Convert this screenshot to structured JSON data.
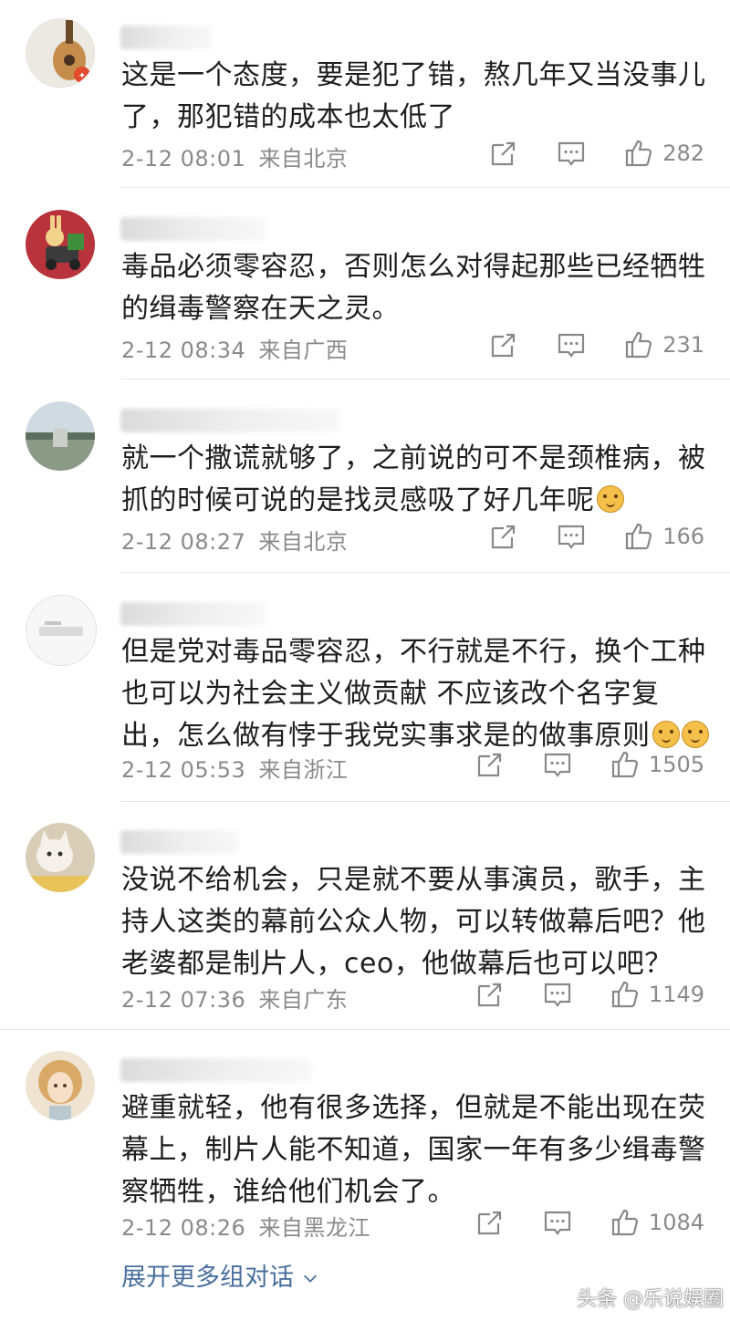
{
  "colors": {
    "text": "#1e1e1e",
    "meta": "#8a8a8a",
    "link": "#4a6f9e",
    "divider": "#e6e6e6"
  },
  "comments": [
    {
      "text": "这是一个态度，要是犯了错，熬几年又当没事儿了，那犯错的成本也太低了",
      "emoji": "",
      "timestamp": "2-12 08:01",
      "location": "来自北京",
      "likes": "282"
    },
    {
      "text": "毒品必须零容忍，否则怎么对得起那些已经牺牲的缉毒警察在天之灵。",
      "emoji": "",
      "timestamp": "2-12 08:34",
      "location": "来自广西",
      "likes": "231"
    },
    {
      "text": "就一个撒谎就够了，之前说的可不是颈椎病，被抓的时候可说的是找灵感吸了好几年呢",
      "emoji": "dog-emoji",
      "timestamp": "2-12 08:27",
      "location": "来自北京",
      "likes": "166"
    },
    {
      "text": "但是党对毒品零容忍，不行就是不行，换个工种也可以为社会主义做贡献 不应该改个名字复出，怎么做有悖于我党实事求是的做事原则",
      "emoji": "dog-emoji x2",
      "timestamp": "2-12 05:53",
      "location": "来自浙江",
      "likes": "1505"
    },
    {
      "text": "没说不给机会，只是就不要从事演员，歌手，主持人这类的幕前公众人物，可以转做幕后吧？他老婆都是制片人，ceo，他做幕后也可以吧？",
      "emoji": "",
      "timestamp": "2-12 07:36",
      "location": "来自广东",
      "likes": "1149"
    },
    {
      "text": "避重就轻，他有很多选择，但就是不能出现在荧幕上，制片人能不知道，国家一年有多少缉毒警察牺牲，谁给他们机会了。",
      "emoji": "",
      "timestamp": "2-12 08:26",
      "location": "来自黑龙江",
      "likes": "1084"
    }
  ],
  "expand_label": "展开更多组对话",
  "watermark": "头条 @乐说娱圈"
}
